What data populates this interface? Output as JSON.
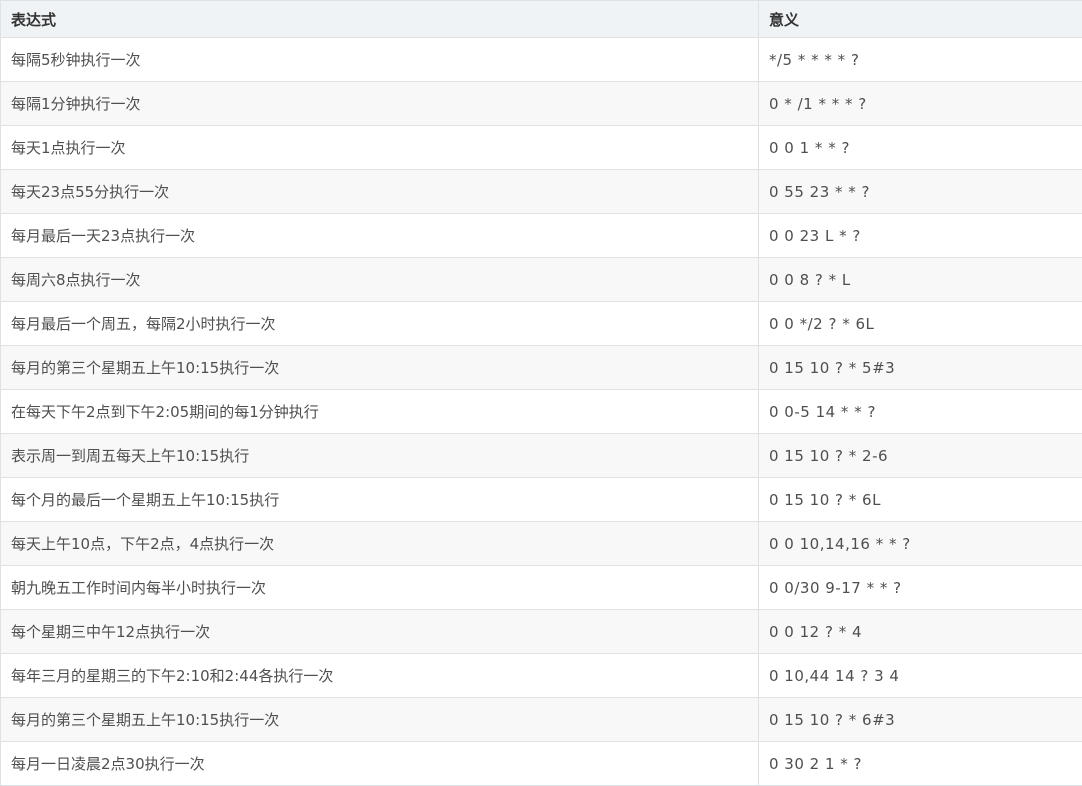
{
  "table": {
    "headers": [
      "表达式",
      "意义"
    ],
    "rows": [
      [
        "每隔5秒钟执行一次",
        "*/5 * * * * ?"
      ],
      [
        "每隔1分钟执行一次",
        "0 * /1 * * * ?"
      ],
      [
        "每天1点执行一次",
        "0 0 1 * * ?"
      ],
      [
        "每天23点55分执行一次",
        "0 55 23 * * ?"
      ],
      [
        "每月最后一天23点执行一次",
        "0 0 23 L * ?"
      ],
      [
        "每周六8点执行一次",
        "0 0 8 ? * L"
      ],
      [
        "每月最后一个周五，每隔2小时执行一次",
        "0 0 */2 ? * 6L"
      ],
      [
        "每月的第三个星期五上午10:15执行一次",
        "0 15 10 ? * 5#3"
      ],
      [
        "在每天下午2点到下午2:05期间的每1分钟执行",
        "0 0-5 14 * * ?"
      ],
      [
        "表示周一到周五每天上午10:15执行",
        "0 15 10 ? * 2-6"
      ],
      [
        "每个月的最后一个星期五上午10:15执行",
        "0 15 10 ? * 6L"
      ],
      [
        "每天上午10点，下午2点，4点执行一次",
        "0 0 10,14,16 * * ?"
      ],
      [
        "朝九晚五工作时间内每半小时执行一次",
        "0 0/30 9-17 * * ?"
      ],
      [
        "每个星期三中午12点执行一次",
        "0 0 12 ? * 4"
      ],
      [
        "每年三月的星期三的下午2:10和2:44各执行一次",
        "0 10,44 14 ? 3 4"
      ],
      [
        "每月的第三个星期五上午10:15执行一次",
        "0 15 10 ? * 6#3"
      ],
      [
        "每月一日凌晨2点30执行一次",
        "0 30 2 1 * ?"
      ]
    ]
  }
}
